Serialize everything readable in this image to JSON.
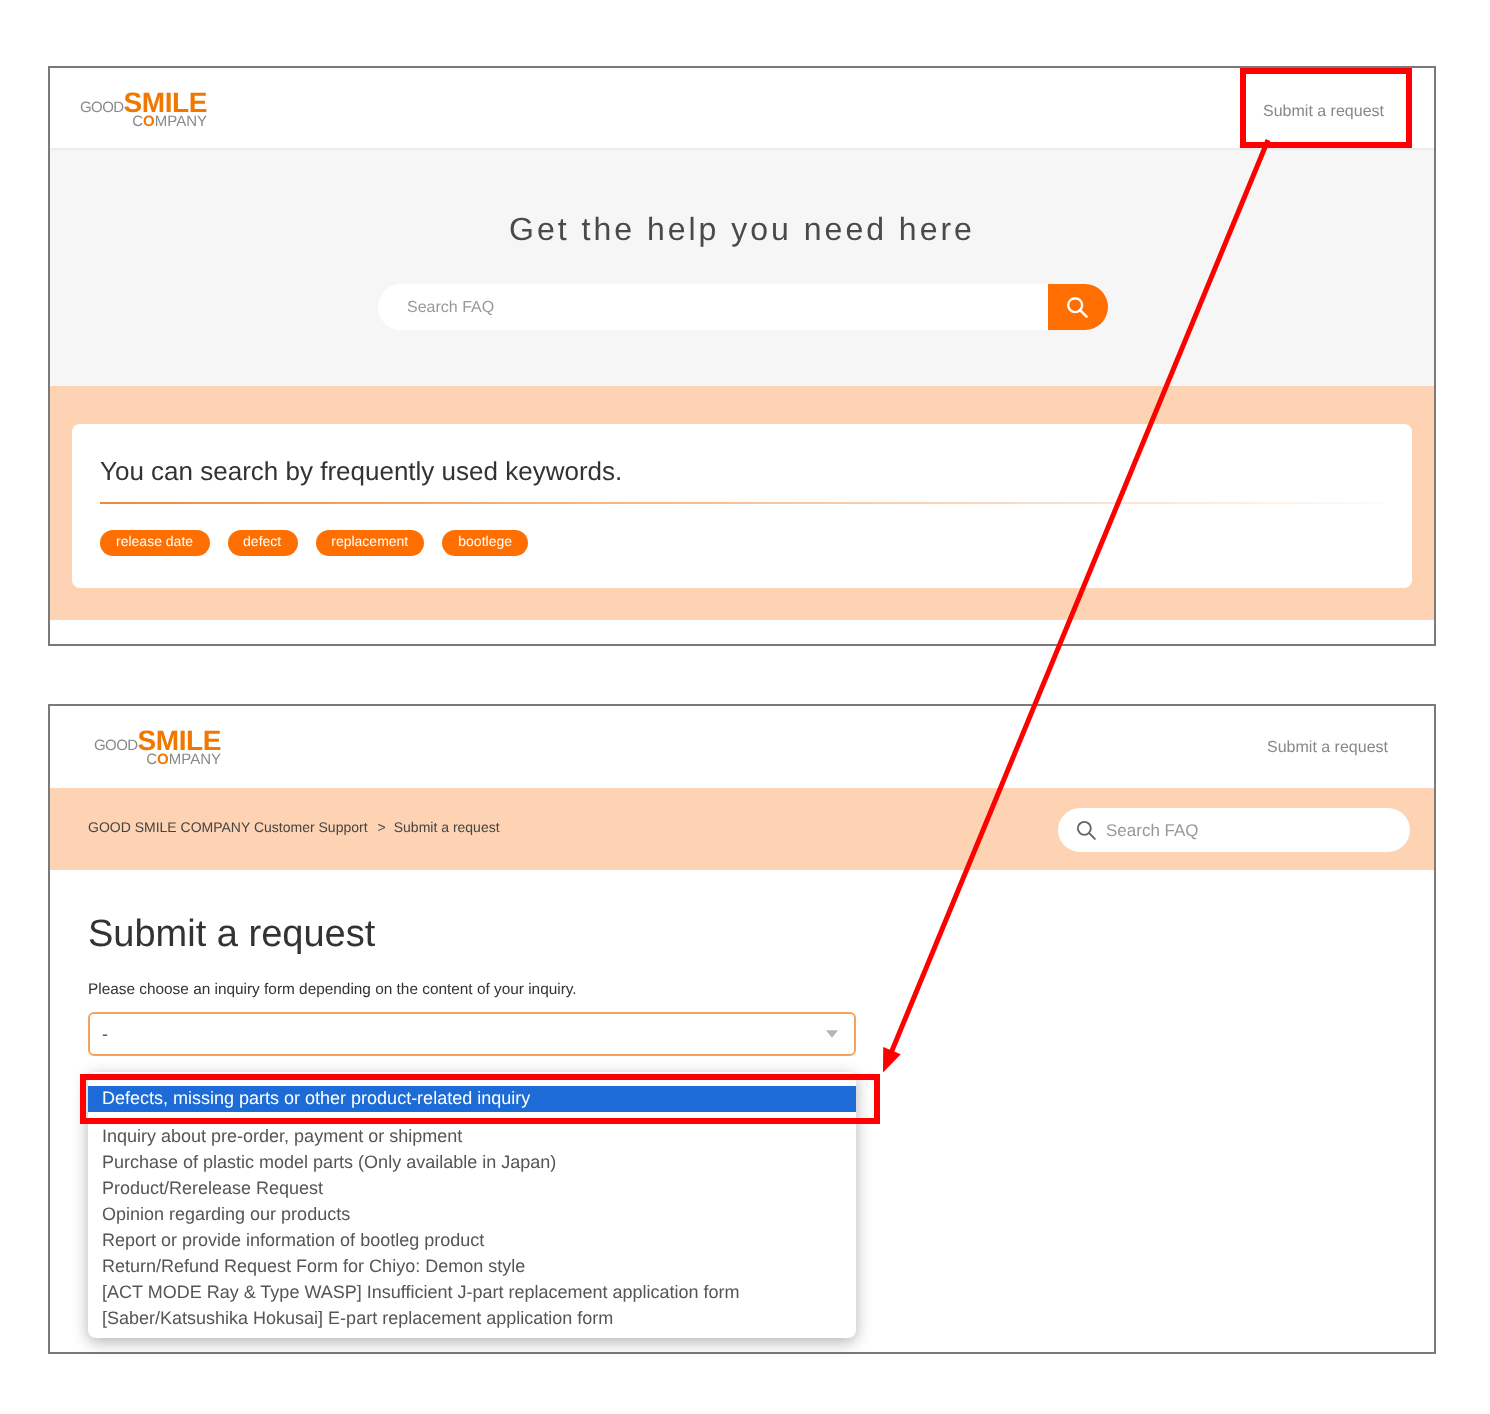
{
  "home_page": {
    "header": {
      "logo": {
        "word_1": "GOOD",
        "word_2": "SMILE",
        "word_3": "C**O**MPANY"
      },
      "link": {
        "label": "Submit a request",
        "highlighted": true
      }
    },
    "hero": {
      "title": "Get the help you need here",
      "search": {
        "placeholder": "Search FAQ"
      }
    },
    "keywords": {
      "title": "You can search by frequently used keywords.",
      "tags": [
        "release date",
        "defect",
        "replacement",
        "bootlege"
      ]
    }
  },
  "request_page": {
    "header": {
      "logo": {
        "word_1": "GOOD",
        "word_2": "SMILE",
        "word_3": "C**O**MPANY"
      },
      "link": {
        "label": "Submit a request"
      }
    },
    "breadcrumb": {
      "parent": "GOOD SMILE COMPANY Customer Support",
      "separator": ">",
      "current": "Submit a request"
    },
    "search": {
      "placeholder": "Search FAQ"
    },
    "title": "Submit a request",
    "form": {
      "label": "Please choose an inquiry form depending on the content of your inquiry.",
      "select": {
        "value": "-",
        "expanded": true,
        "options": [
          {
            "label": "Defects, missing parts or other product-related inquiry",
            "selected": true,
            "highlighted": true
          },
          {
            "label": "Inquiry about pre-order, payment or shipment",
            "selected": false,
            "highlighted": false
          },
          {
            "label": "Purchase of plastic model parts (Only available in Japan)",
            "selected": false,
            "highlighted": false
          },
          {
            "label": "Product/Rerelease Request",
            "selected": false,
            "highlighted": false
          },
          {
            "label": "Opinion regarding our products",
            "selected": false,
            "highlighted": false
          },
          {
            "label": "Report or provide information of bootleg product",
            "selected": false,
            "highlighted": false
          },
          {
            "label": "Return/Refund Request Form for Chiyo: Demon style",
            "selected": false,
            "highlighted": false
          },
          {
            "label": "[ACT MODE Ray & Type WASP] Insufficient J-part replacement application form",
            "selected": false,
            "highlighted": false
          },
          {
            "label": "[Saber/Katsushika Hokusai] E-part replacement application form",
            "selected": false,
            "highlighted": false
          }
        ]
      }
    }
  }
}
